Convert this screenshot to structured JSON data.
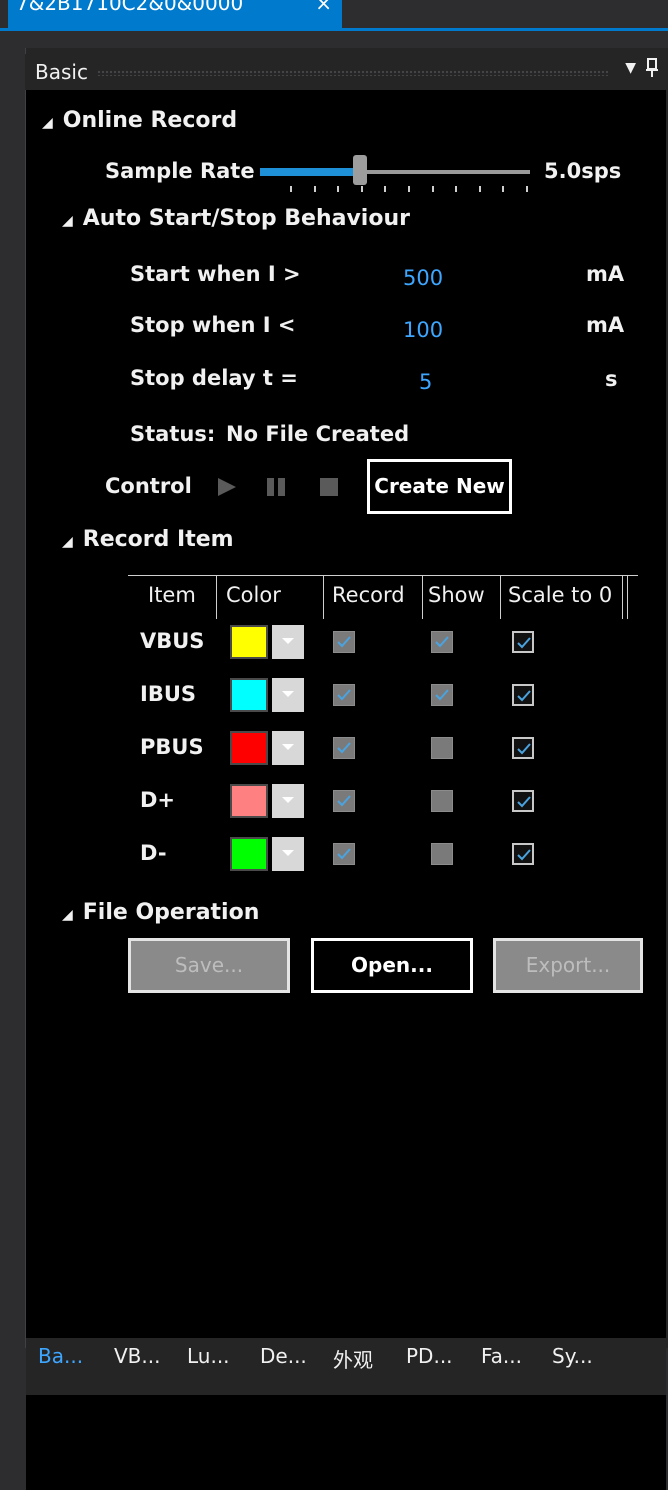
{
  "window": {
    "doc_tab_title": "7&2B1710C2&0&0000",
    "doc_tab_close": "×"
  },
  "panel": {
    "title": "Basic",
    "dropdown_glyph": "▼",
    "pin_glyph": "ф"
  },
  "online_record": {
    "header": "Online Record",
    "sample_rate_label": "Sample Rate",
    "sample_rate_value": "5.0sps",
    "slider_fraction": 0.36
  },
  "auto": {
    "header": "Auto Start/Stop Behaviour",
    "start_label": "Start when I >",
    "start_value": "500",
    "start_unit": "mA",
    "stop_label": "Stop when I <",
    "stop_value": "100",
    "stop_unit": "mA",
    "delay_label": "Stop delay  t =",
    "delay_value": "5",
    "delay_unit": "s",
    "status_label": "Status:",
    "status_value": "No File Created",
    "control_label": "Control",
    "create_new": "Create New"
  },
  "record_item": {
    "header": "Record Item",
    "columns": [
      "Item",
      "Color",
      "Record",
      "Show",
      "Scale to 0"
    ],
    "rows": [
      {
        "item": "VBUS",
        "color": "#ffff00",
        "record": true,
        "show": true,
        "scale": true
      },
      {
        "item": "IBUS",
        "color": "#00ffff",
        "record": true,
        "show": true,
        "scale": true
      },
      {
        "item": "PBUS",
        "color": "#ff0000",
        "record": true,
        "show": false,
        "scale": true
      },
      {
        "item": "D+",
        "color": "#ff8080",
        "record": true,
        "show": false,
        "scale": true
      },
      {
        "item": "D-",
        "color": "#00ff00",
        "record": true,
        "show": false,
        "scale": true
      }
    ]
  },
  "file_operation": {
    "header": "File Operation",
    "save": "Save...",
    "open": "Open...",
    "export": "Export..."
  },
  "bottom_tabs": [
    "Ba...",
    "VB...",
    "Lu...",
    "De...",
    "外观",
    "PD...",
    "Fa...",
    "Sy..."
  ],
  "colors": {
    "accent": "#007acc",
    "value_blue": "#3ea6ff"
  }
}
